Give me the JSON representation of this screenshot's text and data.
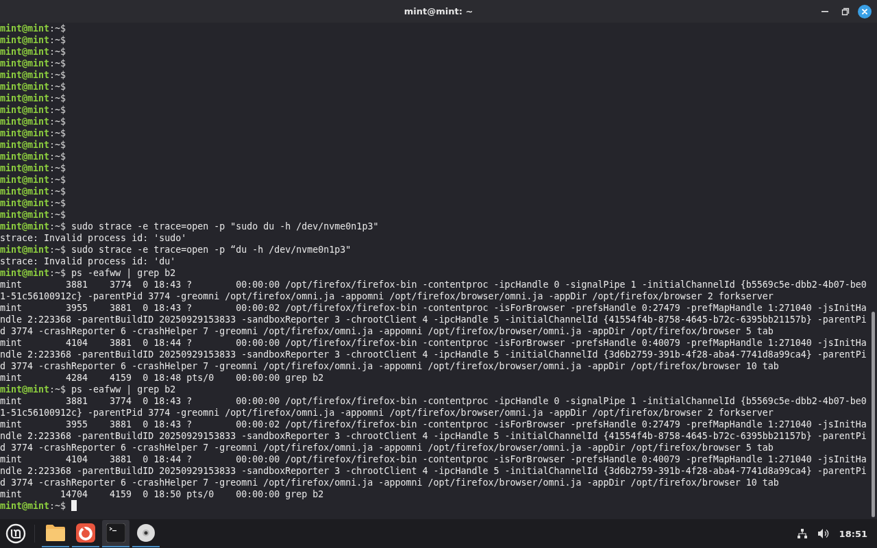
{
  "window": {
    "title": "mint@mint: ~"
  },
  "terminal": {
    "cursor": true,
    "lines": [
      {
        "kind": "prompt",
        "user": "mint@mint",
        "path": ":~$"
      },
      {
        "kind": "prompt",
        "user": "mint@mint",
        "path": ":~$"
      },
      {
        "kind": "prompt",
        "user": "mint@mint",
        "path": ":~$"
      },
      {
        "kind": "prompt",
        "user": "mint@mint",
        "path": ":~$"
      },
      {
        "kind": "prompt",
        "user": "mint@mint",
        "path": ":~$"
      },
      {
        "kind": "prompt",
        "user": "mint@mint",
        "path": ":~$"
      },
      {
        "kind": "prompt",
        "user": "mint@mint",
        "path": ":~$"
      },
      {
        "kind": "prompt",
        "user": "mint@mint",
        "path": ":~$"
      },
      {
        "kind": "prompt",
        "user": "mint@mint",
        "path": ":~$"
      },
      {
        "kind": "prompt",
        "user": "mint@mint",
        "path": ":~$"
      },
      {
        "kind": "prompt",
        "user": "mint@mint",
        "path": ":~$"
      },
      {
        "kind": "prompt",
        "user": "mint@mint",
        "path": ":~$"
      },
      {
        "kind": "prompt",
        "user": "mint@mint",
        "path": ":~$"
      },
      {
        "kind": "prompt",
        "user": "mint@mint",
        "path": ":~$"
      },
      {
        "kind": "prompt",
        "user": "mint@mint",
        "path": ":~$"
      },
      {
        "kind": "prompt",
        "user": "mint@mint",
        "path": ":~$"
      },
      {
        "kind": "prompt",
        "user": "mint@mint",
        "path": ":~$"
      },
      {
        "kind": "prompt",
        "user": "mint@mint",
        "path": ":~$",
        "command": "sudo strace -e trace=open -p \"sudo du -h /dev/nvme0n1p3\""
      },
      {
        "kind": "output",
        "text": "strace: Invalid process id: 'sudo'"
      },
      {
        "kind": "prompt",
        "user": "mint@mint",
        "path": ":~$",
        "command": "sudo strace -e trace=open -p “du -h /dev/nvme0n1p3\""
      },
      {
        "kind": "output",
        "text": "strace: Invalid process id: 'du'"
      },
      {
        "kind": "prompt",
        "user": "mint@mint",
        "path": ":~$",
        "command": "ps -eafww | grep b2"
      },
      {
        "kind": "output",
        "text": "mint        3881    3774  0 18:43 ?        00:00:00 /opt/firefox/firefox-bin -contentproc -ipcHandle 0 -signalPipe 1 -initialChannelId {b5569c5e-dbb2-4b07-be0"
      },
      {
        "kind": "output",
        "text": "1-51c56100912c} -parentPid 3774 -greomni /opt/firefox/omni.ja -appomni /opt/firefox/browser/omni.ja -appDir /opt/firefox/browser 2 forkserver"
      },
      {
        "kind": "output",
        "text": "mint        3955    3881  0 18:43 ?        00:00:02 /opt/firefox/firefox-bin -contentproc -isForBrowser -prefsHandle 0:27479 -prefMapHandle 1:271040 -jsInitHa"
      },
      {
        "kind": "output",
        "text": "ndle 2:223368 -parentBuildID 20250929153833 -sandboxReporter 3 -chrootClient 4 -ipcHandle 5 -initialChannelId {41554f4b-8758-4645-b72c-6395bb21157b} -parentPi"
      },
      {
        "kind": "output",
        "text": "d 3774 -crashReporter 6 -crashHelper 7 -greomni /opt/firefox/omni.ja -appomni /opt/firefox/browser/omni.ja -appDir /opt/firefox/browser 5 tab"
      },
      {
        "kind": "output",
        "text": "mint        4104    3881  0 18:44 ?        00:00:00 /opt/firefox/firefox-bin -contentproc -isForBrowser -prefsHandle 0:40079 -prefMapHandle 1:271040 -jsInitHa"
      },
      {
        "kind": "output",
        "text": "ndle 2:223368 -parentBuildID 20250929153833 -sandboxReporter 3 -chrootClient 4 -ipcHandle 5 -initialChannelId {3d6b2759-391b-4f28-aba4-7741d8a99ca4} -parentPi"
      },
      {
        "kind": "output",
        "text": "d 3774 -crashReporter 6 -crashHelper 7 -greomni /opt/firefox/omni.ja -appomni /opt/firefox/browser/omni.ja -appDir /opt/firefox/browser 10 tab"
      },
      {
        "kind": "output",
        "text": "mint        4284    4159  0 18:48 pts/0    00:00:00 grep b2"
      },
      {
        "kind": "prompt",
        "user": "mint@mint",
        "path": ":~$",
        "command": "ps -eafww | grep b2"
      },
      {
        "kind": "output",
        "text": "mint        3881    3774  0 18:43 ?        00:00:00 /opt/firefox/firefox-bin -contentproc -ipcHandle 0 -signalPipe 1 -initialChannelId {b5569c5e-dbb2-4b07-be0"
      },
      {
        "kind": "output",
        "text": "1-51c56100912c} -parentPid 3774 -greomni /opt/firefox/omni.ja -appomni /opt/firefox/browser/omni.ja -appDir /opt/firefox/browser 2 forkserver"
      },
      {
        "kind": "output",
        "text": "mint        3955    3881  0 18:43 ?        00:00:02 /opt/firefox/firefox-bin -contentproc -isForBrowser -prefsHandle 0:27479 -prefMapHandle 1:271040 -jsInitHa"
      },
      {
        "kind": "output",
        "text": "ndle 2:223368 -parentBuildID 20250929153833 -sandboxReporter 3 -chrootClient 4 -ipcHandle 5 -initialChannelId {41554f4b-8758-4645-b72c-6395bb21157b} -parentPi"
      },
      {
        "kind": "output",
        "text": "d 3774 -crashReporter 6 -crashHelper 7 -greomni /opt/firefox/omni.ja -appomni /opt/firefox/browser/omni.ja -appDir /opt/firefox/browser 5 tab"
      },
      {
        "kind": "output",
        "text": "mint        4104    3881  0 18:44 ?        00:00:00 /opt/firefox/firefox-bin -contentproc -isForBrowser -prefsHandle 0:40079 -prefMapHandle 1:271040 -jsInitHa"
      },
      {
        "kind": "output",
        "text": "ndle 2:223368 -parentBuildID 20250929153833 -sandboxReporter 3 -chrootClient 4 -ipcHandle 5 -initialChannelId {3d6b2759-391b-4f28-aba4-7741d8a99ca4} -parentPi"
      },
      {
        "kind": "output",
        "text": "d 3774 -crashReporter 6 -crashHelper 7 -greomni /opt/firefox/omni.ja -appomni /opt/firefox/browser/omni.ja -appDir /opt/firefox/browser 10 tab"
      },
      {
        "kind": "output",
        "text": "mint       14704    4159  0 18:50 pts/0    00:00:00 grep b2"
      },
      {
        "kind": "prompt",
        "user": "mint@mint",
        "path": ":~$"
      }
    ]
  },
  "taskbar": {
    "apps": [
      {
        "kind": "files",
        "running": true,
        "selected": false
      },
      {
        "kind": "browser",
        "running": true,
        "selected": false
      },
      {
        "kind": "terminal",
        "running": true,
        "selected": true
      },
      {
        "kind": "disc",
        "running": true,
        "selected": false
      }
    ],
    "clock": "18:51"
  }
}
